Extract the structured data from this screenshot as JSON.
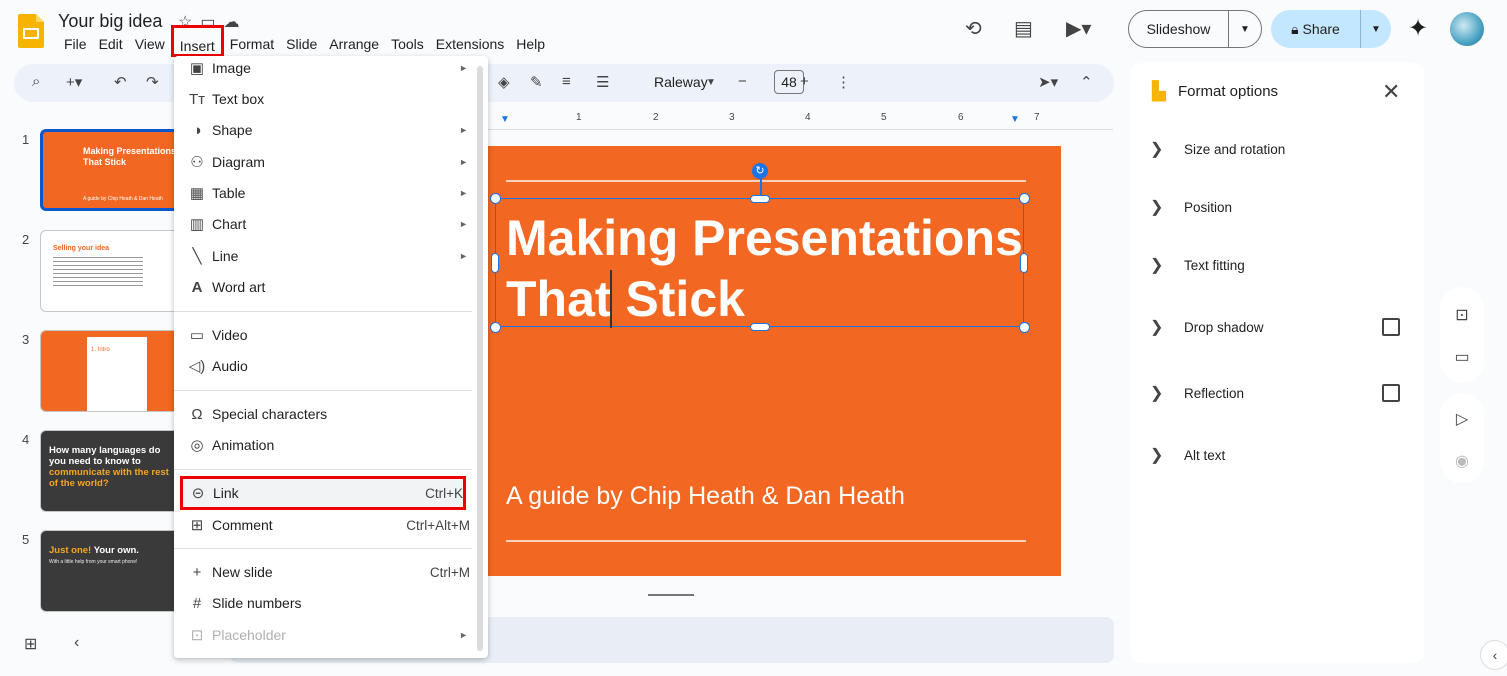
{
  "doc": {
    "title": "Your big idea"
  },
  "menubar": [
    "File",
    "Edit",
    "View",
    "Insert",
    "Format",
    "Slide",
    "Arrange",
    "Tools",
    "Extensions",
    "Help"
  ],
  "header": {
    "slideshow_label": "Slideshow",
    "share_label": "Share"
  },
  "toolbar": {
    "font_name": "Raleway",
    "font_size": "48"
  },
  "ruler_labels": [
    "1",
    "2",
    "3",
    "4",
    "5",
    "6",
    "7"
  ],
  "filmstrip": {
    "slides": [
      {
        "num": "1",
        "title": "Making Presentations That Stick",
        "subtitle": "A guide by Chip Heath & Dan Heath"
      },
      {
        "num": "2",
        "title": "Selling your idea"
      },
      {
        "num": "3",
        "title": "1. Intro"
      },
      {
        "num": "4",
        "line1": "How many languages do you need to know to",
        "line2": "communicate with the rest of the world?"
      },
      {
        "num": "5",
        "accent": "Just one!",
        "rest": " Your own.",
        "sub": "With a little help from your smart phone!"
      }
    ]
  },
  "slide": {
    "title": "Making Presentations That Stick",
    "subtitle": "A guide by Chip Heath & Dan Heath"
  },
  "insert_menu": {
    "items": [
      {
        "label": "Image",
        "icon": "image-icon",
        "submenu": true
      },
      {
        "label": "Text box",
        "icon": "text-box-icon"
      },
      {
        "label": "Shape",
        "icon": "shape-icon",
        "submenu": true
      },
      {
        "label": "Diagram",
        "icon": "diagram-icon",
        "submenu": true
      },
      {
        "label": "Table",
        "icon": "table-icon",
        "submenu": true
      },
      {
        "label": "Chart",
        "icon": "chart-icon",
        "submenu": true
      },
      {
        "label": "Line",
        "icon": "line-icon",
        "submenu": true
      },
      {
        "label": "Word art",
        "icon": "word-art-icon"
      },
      {
        "label": "Video",
        "icon": "video-icon"
      },
      {
        "label": "Audio",
        "icon": "audio-icon"
      },
      {
        "label": "Special characters",
        "icon": "special-characters-icon"
      },
      {
        "label": "Animation",
        "icon": "animation-icon"
      },
      {
        "label": "Link",
        "icon": "link-icon",
        "shortcut": "Ctrl+K"
      },
      {
        "label": "Comment",
        "icon": "comment-icon",
        "shortcut": "Ctrl+Alt+M"
      },
      {
        "label": "New slide",
        "icon": "plus-icon",
        "shortcut": "Ctrl+M"
      },
      {
        "label": "Slide numbers",
        "icon": "hash-icon"
      },
      {
        "label": "Placeholder",
        "icon": "placeholder-icon",
        "submenu": true,
        "disabled": true
      }
    ]
  },
  "format_options": {
    "title": "Format options",
    "sections": [
      "Size and rotation",
      "Position",
      "Text fitting",
      "Drop shadow",
      "Reflection",
      "Alt text"
    ]
  },
  "colors": {
    "slide_bg": "#f26722",
    "selection": "#1a73e8",
    "highlight": "#ee0000",
    "share_bg": "#c2e7ff"
  }
}
